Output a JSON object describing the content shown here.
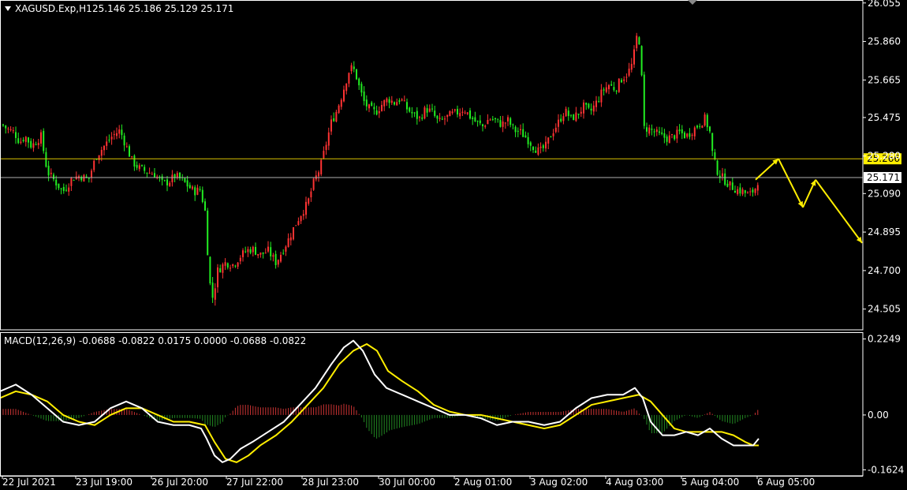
{
  "header": {
    "symbol": "XAGUSD.Exp,H1",
    "ohlc": "25.146 25.186 25.129 25.171",
    "menu_icon": "triangle-down-icon"
  },
  "colors": {
    "background": "#000000",
    "bull": "#ff3333",
    "bear": "#22ee22",
    "grid_frame": "#ffffff",
    "macd_line": "#ffffff",
    "signal_line": "#ffee00",
    "hist_pos": "#cc3333",
    "hist_neg": "#228822",
    "level_line": "#d9c200",
    "bid_line": "#b0b0b0",
    "forecast_arrow": "#ffee00"
  },
  "chart_data": [
    {
      "type": "candlestick",
      "timeframe": "H1",
      "ylim": [
        24.4,
        26.07
      ],
      "y_ticks": [
        "26.055",
        "25.860",
        "25.665",
        "25.475",
        "25.280",
        "25.090",
        "24.895",
        "24.700",
        "24.505"
      ],
      "x_ticks": [
        "22 Jul 2021",
        "23 Jul 19:00",
        "26 Jul 20:00",
        "27 Jul 22:00",
        "28 Jul 23:00",
        "30 Jul 00:00",
        "2 Aug 01:00",
        "3 Aug 02:00",
        "4 Aug 03:00",
        "5 Aug 04:00",
        "6 Aug 05:00"
      ],
      "price_path": [
        [
          0,
          25.45
        ],
        [
          8,
          25.42
        ],
        [
          18,
          25.4
        ],
        [
          25,
          25.35
        ],
        [
          32,
          25.38
        ],
        [
          40,
          25.33
        ],
        [
          52,
          25.38
        ],
        [
          60,
          25.2
        ],
        [
          70,
          25.15
        ],
        [
          80,
          25.1
        ],
        [
          92,
          25.17
        ],
        [
          102,
          25.18
        ],
        [
          112,
          25.16
        ],
        [
          122,
          25.28
        ],
        [
          132,
          25.33
        ],
        [
          142,
          25.38
        ],
        [
          152,
          25.41
        ],
        [
          160,
          25.33
        ],
        [
          168,
          25.25
        ],
        [
          176,
          25.22
        ],
        [
          186,
          25.2
        ],
        [
          196,
          25.19
        ],
        [
          206,
          25.14
        ],
        [
          214,
          25.15
        ],
        [
          222,
          25.18
        ],
        [
          230,
          25.16
        ],
        [
          238,
          25.13
        ],
        [
          246,
          25.1
        ],
        [
          254,
          25.11
        ],
        [
          260,
          25.0
        ],
        [
          264,
          24.75
        ],
        [
          267,
          24.6
        ],
        [
          270,
          24.56
        ],
        [
          276,
          24.7
        ],
        [
          286,
          24.74
        ],
        [
          296,
          24.73
        ],
        [
          304,
          24.77
        ],
        [
          312,
          24.8
        ],
        [
          320,
          24.81
        ],
        [
          330,
          24.78
        ],
        [
          340,
          24.8
        ],
        [
          350,
          24.74
        ],
        [
          358,
          24.8
        ],
        [
          366,
          24.86
        ],
        [
          374,
          24.93
        ],
        [
          382,
          24.99
        ],
        [
          390,
          25.04
        ],
        [
          398,
          25.15
        ],
        [
          406,
          25.22
        ],
        [
          414,
          25.35
        ],
        [
          420,
          25.45
        ],
        [
          426,
          25.5
        ],
        [
          432,
          25.57
        ],
        [
          438,
          25.65
        ],
        [
          444,
          25.73
        ],
        [
          450,
          25.71
        ],
        [
          456,
          25.62
        ],
        [
          462,
          25.55
        ],
        [
          468,
          25.52
        ],
        [
          476,
          25.5
        ],
        [
          484,
          25.54
        ],
        [
          492,
          25.57
        ],
        [
          500,
          25.55
        ],
        [
          508,
          25.57
        ],
        [
          516,
          25.52
        ],
        [
          524,
          25.49
        ],
        [
          532,
          25.47
        ],
        [
          540,
          25.52
        ],
        [
          548,
          25.5
        ],
        [
          556,
          25.45
        ],
        [
          564,
          25.47
        ],
        [
          572,
          25.49
        ],
        [
          580,
          25.5
        ],
        [
          588,
          25.52
        ],
        [
          596,
          25.48
        ],
        [
          604,
          25.45
        ],
        [
          612,
          25.43
        ],
        [
          620,
          25.47
        ],
        [
          628,
          25.46
        ],
        [
          636,
          25.44
        ],
        [
          644,
          25.46
        ],
        [
          652,
          25.41
        ],
        [
          660,
          25.4
        ],
        [
          668,
          25.37
        ],
        [
          676,
          25.33
        ],
        [
          684,
          25.3
        ],
        [
          692,
          25.33
        ],
        [
          700,
          25.4
        ],
        [
          708,
          25.45
        ],
        [
          716,
          25.51
        ],
        [
          724,
          25.47
        ],
        [
          732,
          25.49
        ],
        [
          740,
          25.53
        ],
        [
          748,
          25.5
        ],
        [
          756,
          25.55
        ],
        [
          764,
          25.61
        ],
        [
          772,
          25.64
        ],
        [
          780,
          25.62
        ],
        [
          788,
          25.67
        ],
        [
          796,
          25.7
        ],
        [
          802,
          25.75
        ],
        [
          808,
          25.9
        ],
        [
          812,
          25.84
        ],
        [
          816,
          25.42
        ],
        [
          822,
          25.42
        ],
        [
          830,
          25.4
        ],
        [
          838,
          25.38
        ],
        [
          846,
          25.37
        ],
        [
          854,
          25.38
        ],
        [
          862,
          25.4
        ],
        [
          870,
          25.38
        ],
        [
          878,
          25.41
        ],
        [
          886,
          25.44
        ],
        [
          894,
          25.47
        ],
        [
          900,
          25.4
        ],
        [
          904,
          25.27
        ],
        [
          910,
          25.2
        ],
        [
          918,
          25.16
        ],
        [
          926,
          25.13
        ],
        [
          934,
          25.11
        ],
        [
          942,
          25.1
        ],
        [
          950,
          25.08
        ],
        [
          958,
          25.12
        ],
        [
          962,
          25.17
        ]
      ],
      "levels": [
        {
          "label": "25.266",
          "value": 25.266,
          "role": "level"
        },
        {
          "label": "25.171",
          "value": 25.171,
          "role": "bid"
        }
      ],
      "forecast_path": [
        [
          958,
          25.16
        ],
        [
          987,
          25.266
        ],
        [
          1018,
          25.02
        ],
        [
          1034,
          25.16
        ],
        [
          1093,
          24.84
        ]
      ]
    },
    {
      "type": "line",
      "title": "MACD(12,26,9) -0.0688 -0.0822 0.0175 0.0000 -0.0688 -0.0822",
      "ylim": [
        -0.18,
        0.245
      ],
      "y_ticks": [
        "0.2249",
        "0.00",
        "-0.1624"
      ],
      "series": [
        {
          "name": "MACD",
          "points": [
            [
              0,
              0.07
            ],
            [
              20,
              0.09
            ],
            [
              40,
              0.06
            ],
            [
              60,
              0.02
            ],
            [
              80,
              -0.02
            ],
            [
              100,
              -0.03
            ],
            [
              120,
              -0.02
            ],
            [
              140,
              0.02
            ],
            [
              160,
              0.04
            ],
            [
              180,
              0.02
            ],
            [
              200,
              -0.02
            ],
            [
              220,
              -0.03
            ],
            [
              240,
              -0.03
            ],
            [
              255,
              -0.04
            ],
            [
              262,
              -0.07
            ],
            [
              272,
              -0.12
            ],
            [
              282,
              -0.14
            ],
            [
              292,
              -0.13
            ],
            [
              305,
              -0.1
            ],
            [
              320,
              -0.08
            ],
            [
              340,
              -0.05
            ],
            [
              360,
              -0.02
            ],
            [
              380,
              0.03
            ],
            [
              400,
              0.08
            ],
            [
              420,
              0.15
            ],
            [
              436,
              0.2
            ],
            [
              448,
              0.22
            ],
            [
              460,
              0.19
            ],
            [
              475,
              0.12
            ],
            [
              490,
              0.08
            ],
            [
              510,
              0.06
            ],
            [
              530,
              0.04
            ],
            [
              550,
              0.02
            ],
            [
              570,
              0.0
            ],
            [
              590,
              0.0
            ],
            [
              610,
              -0.01
            ],
            [
              630,
              -0.03
            ],
            [
              650,
              -0.02
            ],
            [
              670,
              -0.02
            ],
            [
              690,
              -0.03
            ],
            [
              710,
              -0.02
            ],
            [
              730,
              0.02
            ],
            [
              750,
              0.05
            ],
            [
              770,
              0.06
            ],
            [
              790,
              0.06
            ],
            [
              805,
              0.08
            ],
            [
              815,
              0.05
            ],
            [
              825,
              -0.02
            ],
            [
              840,
              -0.06
            ],
            [
              855,
              -0.06
            ],
            [
              870,
              -0.05
            ],
            [
              885,
              -0.06
            ],
            [
              900,
              -0.04
            ],
            [
              915,
              -0.07
            ],
            [
              930,
              -0.09
            ],
            [
              945,
              -0.09
            ],
            [
              955,
              -0.09
            ],
            [
              962,
              -0.07
            ]
          ]
        },
        {
          "name": "Signal",
          "points": [
            [
              0,
              0.05
            ],
            [
              20,
              0.07
            ],
            [
              40,
              0.06
            ],
            [
              60,
              0.04
            ],
            [
              80,
              0.0
            ],
            [
              100,
              -0.02
            ],
            [
              120,
              -0.03
            ],
            [
              140,
              0.0
            ],
            [
              160,
              0.02
            ],
            [
              180,
              0.02
            ],
            [
              200,
              0.0
            ],
            [
              220,
              -0.02
            ],
            [
              240,
              -0.02
            ],
            [
              260,
              -0.03
            ],
            [
              272,
              -0.08
            ],
            [
              286,
              -0.13
            ],
            [
              300,
              -0.14
            ],
            [
              315,
              -0.12
            ],
            [
              330,
              -0.09
            ],
            [
              350,
              -0.06
            ],
            [
              370,
              -0.02
            ],
            [
              390,
              0.03
            ],
            [
              410,
              0.08
            ],
            [
              430,
              0.15
            ],
            [
              448,
              0.19
            ],
            [
              465,
              0.21
            ],
            [
              478,
              0.19
            ],
            [
              492,
              0.13
            ],
            [
              510,
              0.1
            ],
            [
              530,
              0.07
            ],
            [
              550,
              0.03
            ],
            [
              570,
              0.01
            ],
            [
              590,
              0.0
            ],
            [
              610,
              0.0
            ],
            [
              630,
              -0.01
            ],
            [
              650,
              -0.02
            ],
            [
              670,
              -0.03
            ],
            [
              690,
              -0.04
            ],
            [
              710,
              -0.03
            ],
            [
              730,
              0.0
            ],
            [
              750,
              0.03
            ],
            [
              770,
              0.04
            ],
            [
              790,
              0.05
            ],
            [
              810,
              0.06
            ],
            [
              825,
              0.04
            ],
            [
              840,
              0.0
            ],
            [
              855,
              -0.04
            ],
            [
              870,
              -0.05
            ],
            [
              885,
              -0.05
            ],
            [
              900,
              -0.05
            ],
            [
              915,
              -0.05
            ],
            [
              930,
              -0.06
            ],
            [
              945,
              -0.08
            ],
            [
              955,
              -0.09
            ],
            [
              962,
              -0.09
            ]
          ]
        }
      ]
    }
  ]
}
